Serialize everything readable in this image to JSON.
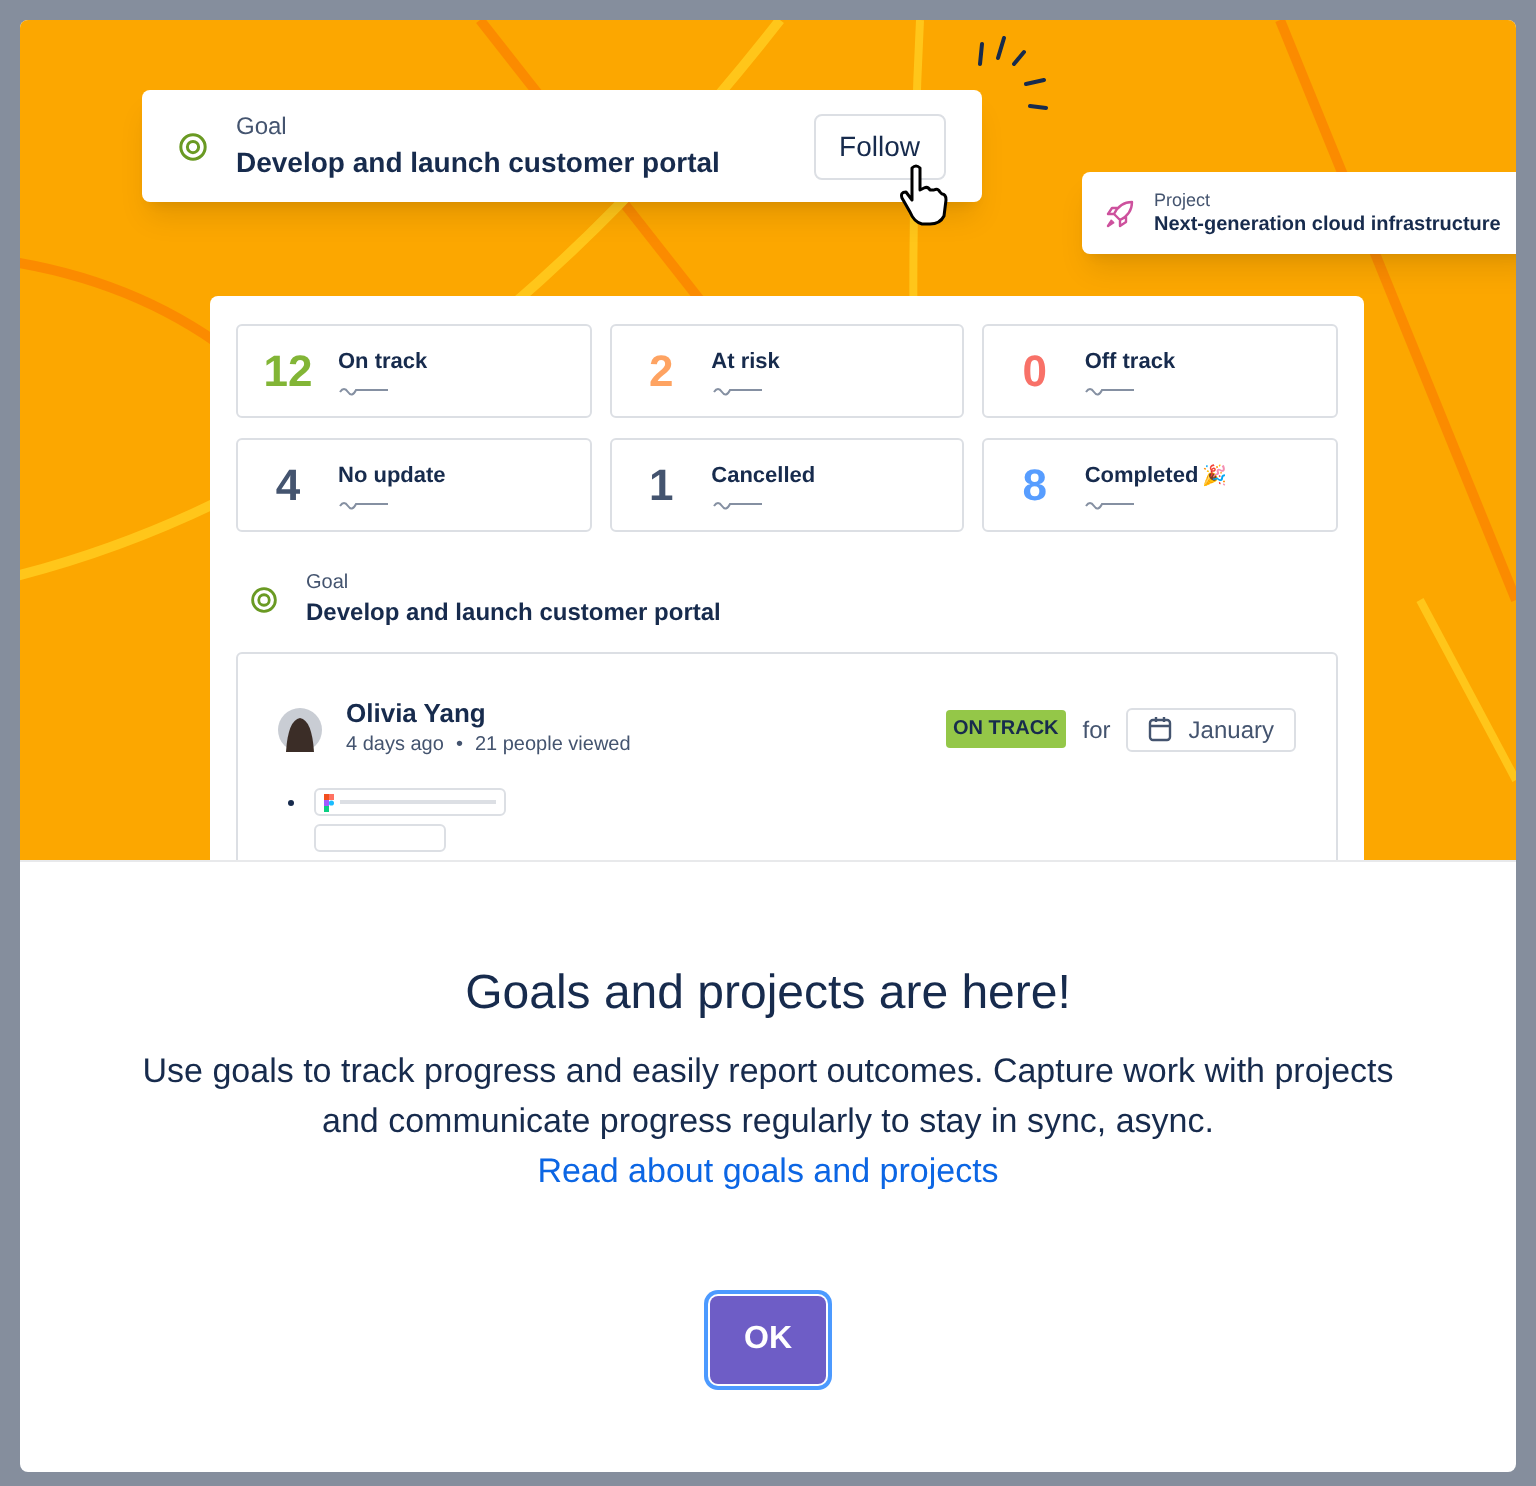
{
  "hero": {
    "goal_card": {
      "label": "Goal",
      "title": "Develop and launch customer portal",
      "button": "Follow"
    },
    "project_card": {
      "label": "Project",
      "title": "Next-generation cloud infrastructure"
    },
    "stats": [
      {
        "count": "12",
        "label": "On track",
        "color": "#82b536"
      },
      {
        "count": "2",
        "label": "At risk",
        "color": "#fea362"
      },
      {
        "count": "0",
        "label": "Off track",
        "color": "#f87168"
      },
      {
        "count": "4",
        "label": "No update",
        "color": "#44546f"
      },
      {
        "count": "1",
        "label": "Cancelled",
        "color": "#44546f"
      },
      {
        "count": "8",
        "label": "Completed",
        "color": "#579dff",
        "emoji": "🎉"
      }
    ],
    "goal": {
      "label": "Goal",
      "title": "Develop and launch customer portal"
    },
    "update": {
      "author": "Olivia Yang",
      "time": "4 days ago",
      "separator": "•",
      "views": "21 people viewed",
      "status": "ON TRACK",
      "for": "for",
      "period": "January"
    }
  },
  "dialog": {
    "title": "Goals and projects are here!",
    "body": "Use goals to track progress and easily report outcomes. Capture work with projects and communicate progress regularly to stay in sync, async.",
    "link": "Read about goals and projects",
    "button": "OK"
  }
}
